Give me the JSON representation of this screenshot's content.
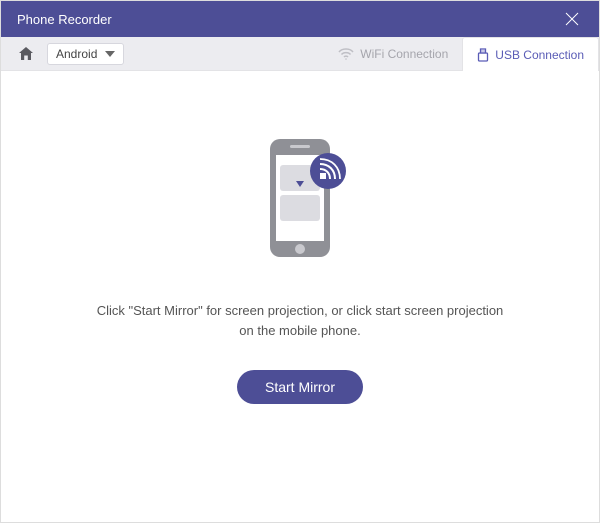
{
  "titlebar": {
    "title": "Phone Recorder"
  },
  "toolbar": {
    "device_label": "Android"
  },
  "tabs": {
    "wifi_label": "WiFi Connection",
    "usb_label": "USB Connection"
  },
  "main": {
    "instruction": "Click \"Start Mirror\" for screen projection, or click start screen projection on the mobile phone.",
    "start_button": "Start Mirror"
  },
  "colors": {
    "accent": "#4d4e96"
  }
}
